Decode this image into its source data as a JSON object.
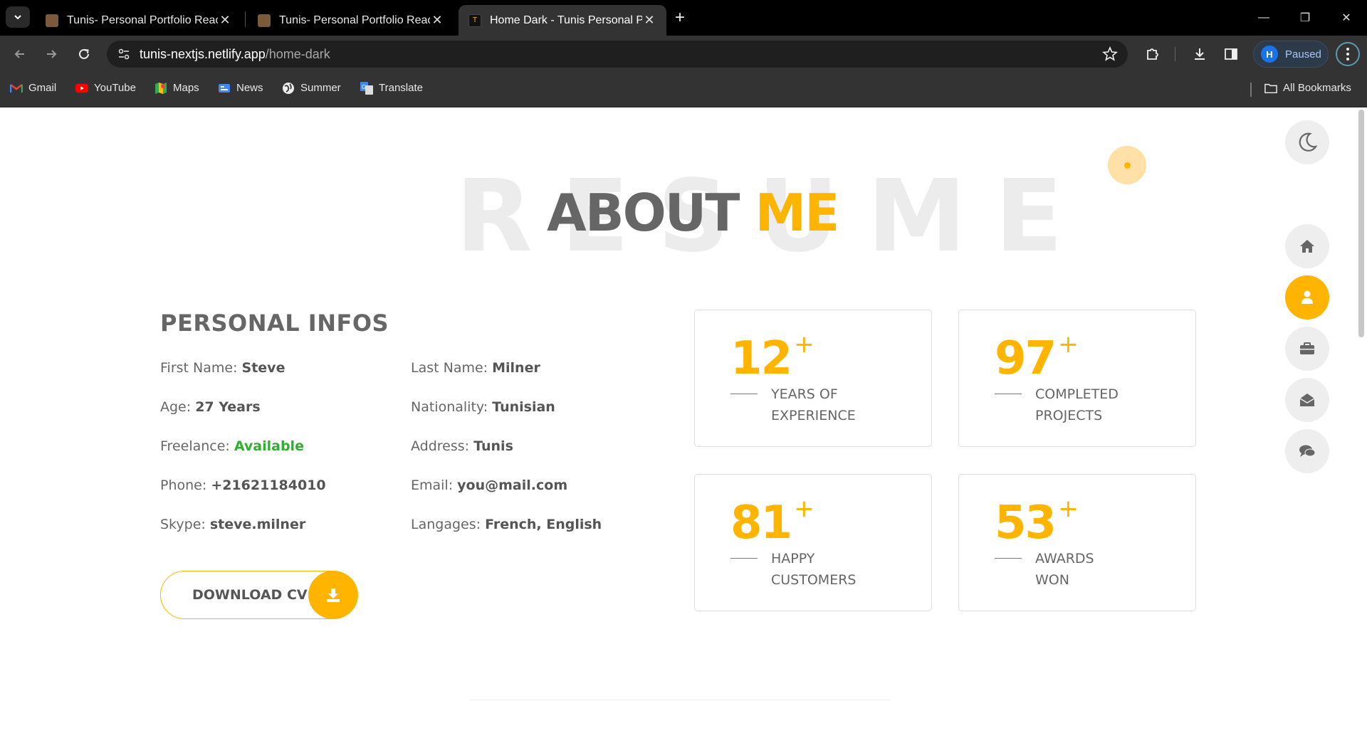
{
  "browser": {
    "tabs": [
      {
        "title": "Tunis- Personal Portfolio React",
        "active": false
      },
      {
        "title": "Tunis- Personal Portfolio React",
        "active": false
      },
      {
        "title": "Home Dark - Tunis Personal Portfolio",
        "active": true
      }
    ],
    "url_host": "tunis-nextjs.netlify.app",
    "url_path": "/home-dark",
    "profile_initial": "H",
    "profile_status": "Paused",
    "bookmarks": [
      "Gmail",
      "YouTube",
      "Maps",
      "News",
      "Summer",
      "Translate"
    ],
    "all_bookmarks": "All Bookmarks"
  },
  "page": {
    "bg_word": "RESUME",
    "heading_part1": "ABOUT",
    "heading_part2": "ME",
    "section_title": "PERSONAL INFOS",
    "infos_left": [
      {
        "label": "First Name:",
        "value": "Steve"
      },
      {
        "label": "Age:",
        "value": "27 Years"
      },
      {
        "label": "Freelance:",
        "value": "Available"
      },
      {
        "label": "Phone:",
        "value": "+21621184010"
      },
      {
        "label": "Skype:",
        "value": "steve.milner"
      }
    ],
    "infos_right": [
      {
        "label": "Last Name:",
        "value": "Milner"
      },
      {
        "label": "Nationality:",
        "value": "Tunisian"
      },
      {
        "label": "Address:",
        "value": "Tunis"
      },
      {
        "label": "Email:",
        "value": "you@mail.com"
      },
      {
        "label": "Langages:",
        "value": "French, English"
      }
    ],
    "download_label": "DOWNLOAD CV",
    "stats": [
      {
        "number": "12",
        "plus": "+",
        "line1": "YEARS OF",
        "line2": "EXPERIENCE"
      },
      {
        "number": "97",
        "plus": "+",
        "line1": "COMPLETED",
        "line2": "PROJECTS"
      },
      {
        "number": "81",
        "plus": "+",
        "line1": "HAPPY",
        "line2": "CUSTOMERS"
      },
      {
        "number": "53",
        "plus": "+",
        "line1": "AWARDS",
        "line2": "WON"
      }
    ]
  },
  "colors": {
    "accent": "#ffb400",
    "text_gray": "#666666",
    "available_green": "#30b030"
  },
  "icons": {
    "side_nav": [
      "moon-icon",
      "home-icon",
      "user-icon",
      "briefcase-icon",
      "envelope-icon",
      "comments-icon"
    ]
  }
}
